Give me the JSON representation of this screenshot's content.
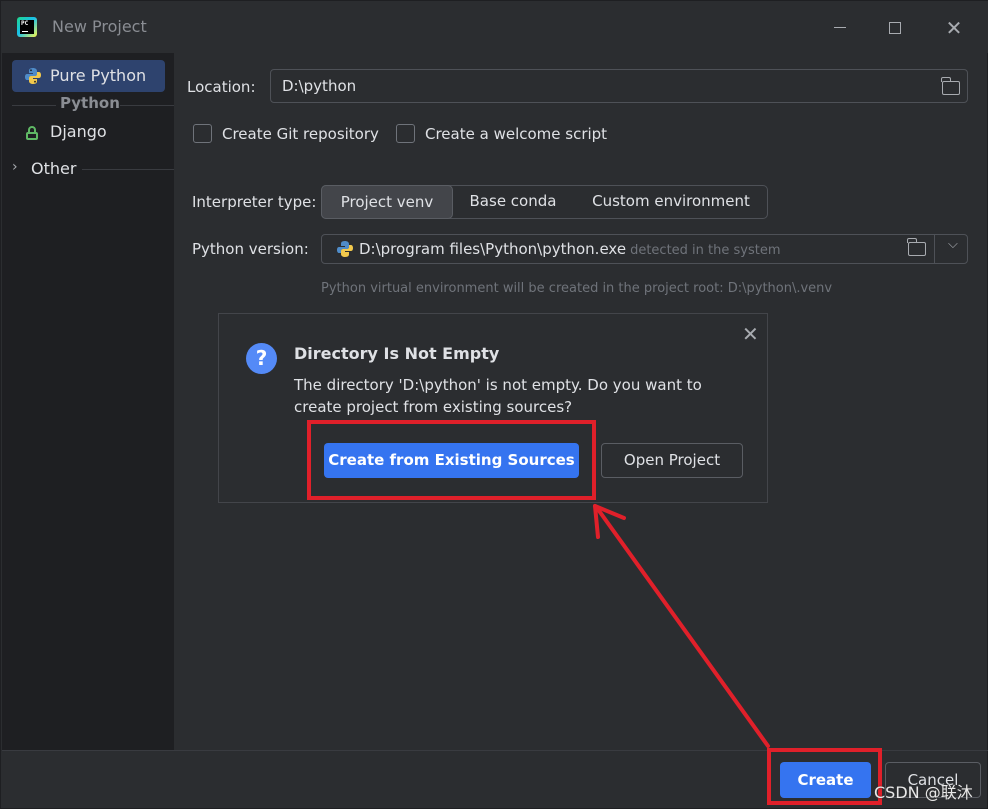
{
  "window": {
    "title": "New Project",
    "app_icon_text": "PC"
  },
  "sidebar": {
    "items": [
      {
        "label": "Pure Python",
        "selected": true
      },
      {
        "label": "Django",
        "selected": false
      },
      {
        "label": "Other",
        "selected": false
      }
    ],
    "group_title": "Python"
  },
  "form": {
    "location_label": "Location:",
    "location_value": "D:\\python",
    "create_git_label": "Create Git repository",
    "create_git_checked": false,
    "welcome_script_label": "Create a welcome script",
    "welcome_script_checked": false,
    "interpreter_label": "Interpreter type:",
    "interpreter_options": [
      "Project venv",
      "Base conda",
      "Custom environment"
    ],
    "interpreter_selected": "Project venv",
    "python_version_label": "Python version:",
    "python_version_path": "D:\\program files\\Python\\python.exe",
    "python_version_note": "detected in the system",
    "venv_hint": "Python virtual environment will be created in the project root: D:\\python\\.venv"
  },
  "popup": {
    "title": "Directory Is Not Empty",
    "message": "The directory 'D:\\python' is not empty. Do you want to create project from existing sources?",
    "primary_button": "Create from Existing Sources",
    "secondary_button": "Open Project"
  },
  "footer": {
    "create_button": "Create",
    "cancel_button": "Cancel"
  },
  "annotation": {
    "watermark": "CSDN @联沐",
    "highlight_color": "#e0202a"
  },
  "colors": {
    "accent": "#3574f0",
    "selection": "#2e436e",
    "background": "#2b2d30",
    "sidebar": "#1e1f22"
  }
}
